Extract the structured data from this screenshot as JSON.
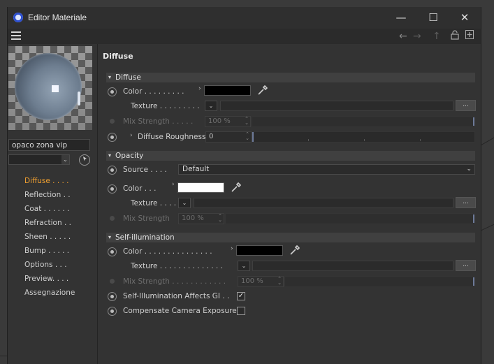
{
  "window": {
    "title": "Editor Materiale",
    "controls": {
      "minimize": "—",
      "maximize": "☐",
      "close": "✕"
    }
  },
  "toolbar": {
    "icons": [
      "menu-icon",
      "back-arrow-icon",
      "forward-arrow-icon",
      "up-arrow-icon",
      "lock-icon",
      "new-window-icon"
    ],
    "glyphs": {
      "back": "←",
      "forward": "→",
      "up": "↑",
      "lock": "🔓",
      "add": "⊞"
    }
  },
  "left": {
    "material_name": "opaco zona vip",
    "channels": [
      {
        "label": "Diffuse . . . .",
        "active": true
      },
      {
        "label": "Reflection . .",
        "active": false
      },
      {
        "label": "Coat . . . . . .",
        "active": false
      },
      {
        "label": "Refraction . .",
        "active": false
      },
      {
        "label": "Sheen . . . . .",
        "active": false
      },
      {
        "label": "Bump . . . . .",
        "active": false
      },
      {
        "label": "Options . . .",
        "active": false
      },
      {
        "label": "Preview. . . .",
        "active": false
      },
      {
        "label": "Assegnazione",
        "active": false
      }
    ]
  },
  "section_title": "Diffuse",
  "groups": {
    "diffuse": "Diffuse",
    "opacity": "Opacity",
    "self_illumination": "Self-illumination"
  },
  "diffuse": {
    "color_label": "Color . . . . . . . . .",
    "color_value": "#000000",
    "texture_label": "Texture . . . . . . . . .",
    "mix_label": "Mix Strength . . . . .",
    "mix_value": "100 %",
    "roughness_label": "Diffuse Roughness",
    "roughness_value": "0"
  },
  "opacity": {
    "source_label": "Source . . . .",
    "source_value": "Default",
    "color_label": "Color . . .",
    "color_value": "#ffffff",
    "texture_label": "Texture . . . .",
    "mix_label": "Mix Strength",
    "mix_value": "100 %"
  },
  "self_illumination": {
    "color_label": "Color . . . . . . . . . . . . . . .",
    "color_value": "#000000",
    "texture_label": "Texture . . . . . . . . . . . . . .",
    "mix_label": "Mix Strength . . . . . . . . . . . .",
    "mix_value": "100 %",
    "affects_gi_label": "Self-Illumination Affects GI . .",
    "affects_gi_checked": true,
    "compensate_label": "Compensate Camera Exposure",
    "compensate_checked": false
  },
  "common": {
    "browse_button": "...",
    "chevron": "›",
    "dropdown_arrow": "⌄",
    "check": "✓",
    "group_triangle": "▾",
    "spin": "⌃⌄"
  }
}
